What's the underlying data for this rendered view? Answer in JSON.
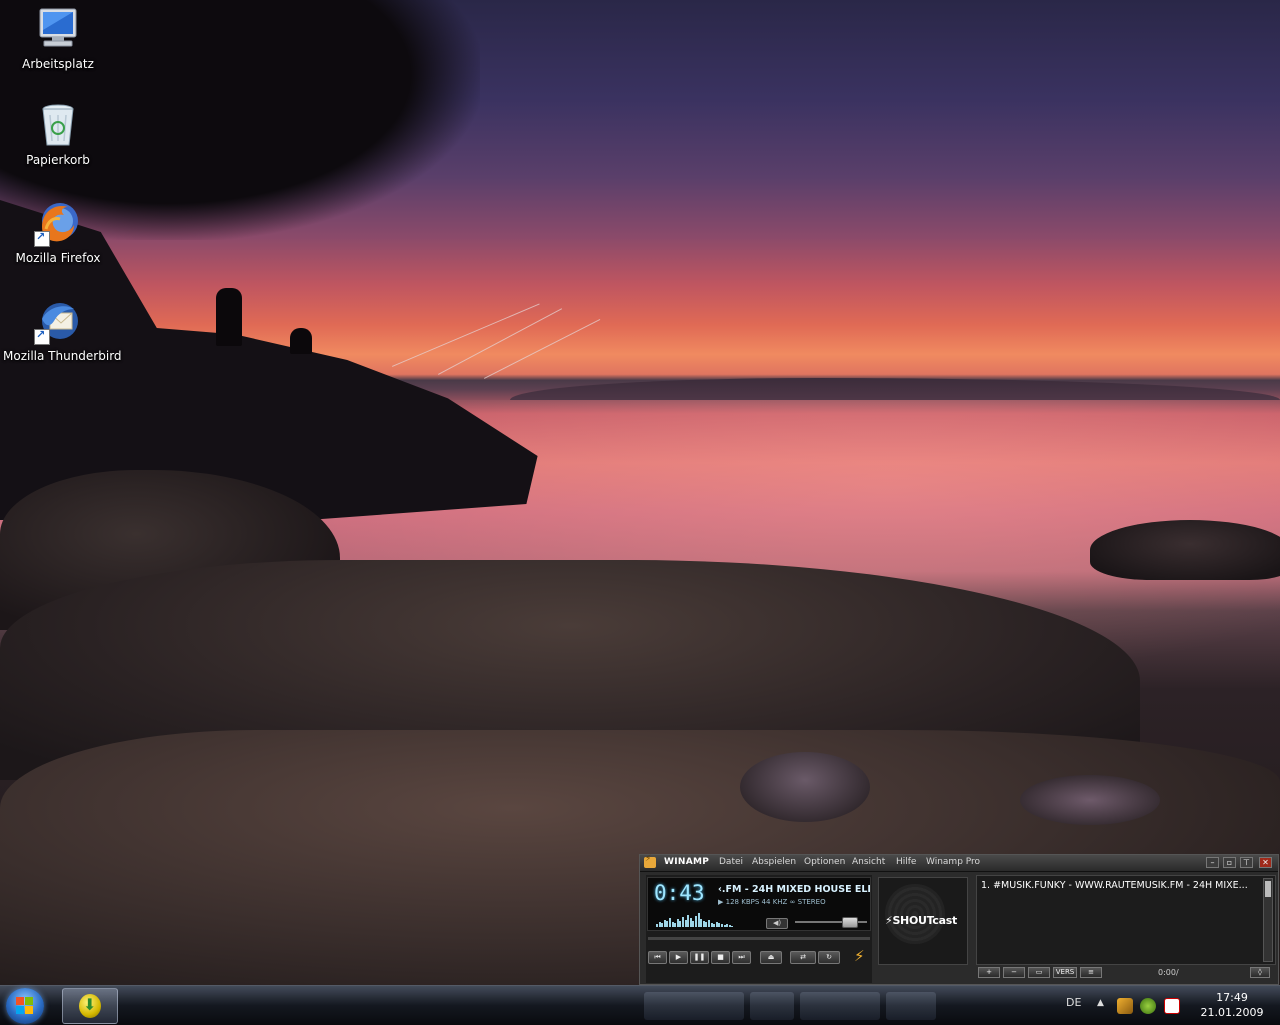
{
  "desktop": {
    "icons": [
      {
        "label": "Arbeitsplatz",
        "icon": "computer-icon"
      },
      {
        "label": "Papierkorb",
        "icon": "recycle-bin-icon"
      },
      {
        "label": "Mozilla Firefox",
        "icon": "firefox-icon"
      },
      {
        "label": "Mozilla Thunderbird",
        "icon": "thunderbird-icon"
      }
    ]
  },
  "winamp": {
    "title": "WINAMP",
    "menu": [
      "Datei",
      "Abspielen",
      "Optionen",
      "Ansicht",
      "Hilfe",
      "Winamp Pro"
    ],
    "time": "0:43",
    "marquee": "‹.FM - 24H MIXED HOUSE ELEC",
    "info": {
      "kbps": "128",
      "kbps_label": "KBPS",
      "khz": "44",
      "khz_label": "KHZ",
      "mode": "STEREO"
    },
    "volume": 0.75,
    "shoutcast_label": "SHOUTcast",
    "playlist": {
      "items": [
        "1. #MUSIK.FUNKY - WWW.RAUTEMUSIK.FM - 24H MIXE..."
      ],
      "time": "0:00/",
      "buttons": [
        "+",
        "−",
        "▭",
        "VERS",
        "≡",
        "◊"
      ]
    }
  },
  "taskbar": {
    "language": "DE",
    "time": "17:49",
    "date": "21.01.2009",
    "tray_icons": [
      "winamp-tray-icon",
      "shield-tray-icon",
      "avira-tray-icon"
    ],
    "accent": "#2a6cc4"
  }
}
